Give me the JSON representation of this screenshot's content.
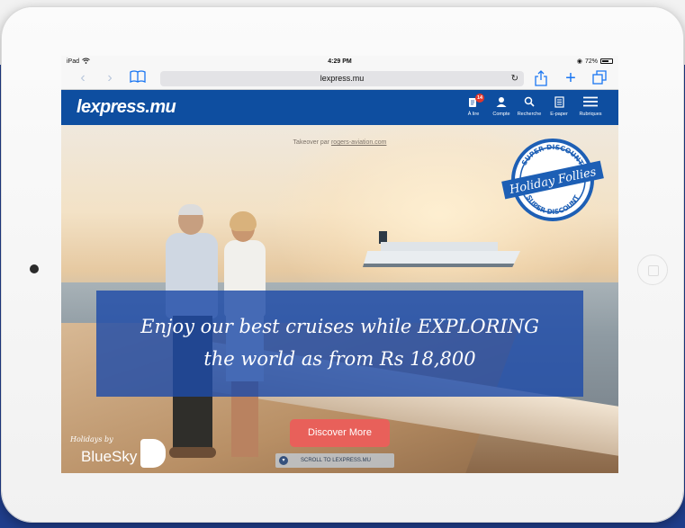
{
  "status_bar": {
    "device": "iPad",
    "time": "4:29 PM",
    "battery": "72%",
    "battery_level": 0.72
  },
  "browser": {
    "url": "lexpress.mu"
  },
  "site_header": {
    "logo": "lexpress.mu",
    "nav": [
      {
        "label": "À lire",
        "badge": "14",
        "icon": "news-icon"
      },
      {
        "label": "Compte",
        "icon": "user-icon"
      },
      {
        "label": "Recherche",
        "icon": "search-icon"
      },
      {
        "label": "E-paper",
        "icon": "epaper-icon"
      },
      {
        "label": "Rubriques",
        "icon": "menu-icon"
      }
    ]
  },
  "hero": {
    "takeover_prefix": "Takeover par",
    "takeover_link": "rogers-aviation.com",
    "stamp": {
      "top": "SUPER DISCOUNT",
      "center": "Holiday Follies",
      "bottom": "SUPER DISCOUNT"
    },
    "headline": "Enjoy our best cruises while EXPLORING the world as from Rs 18,800",
    "cta": "Discover More",
    "brand_small": "Holidays by",
    "brand_big": "BlueSky",
    "scroll_label": "SCROLL TO LEXPRESS.MU"
  },
  "colors": {
    "site_header_bg": "#0e4ea0",
    "promo_bg": "#1f4ca8",
    "cta_bg": "#e8605a",
    "badge_bg": "#e0362b"
  }
}
